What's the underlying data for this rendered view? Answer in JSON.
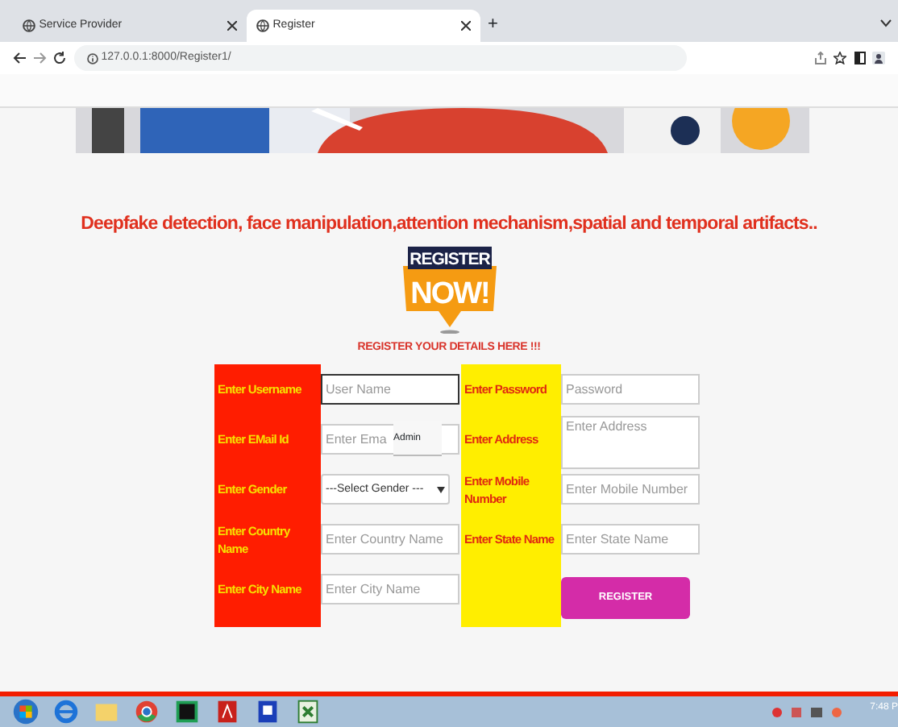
{
  "browser": {
    "tabs": [
      {
        "title": "Service Provider",
        "selected": false
      },
      {
        "title": "Register",
        "selected": true
      }
    ],
    "new_tab": "+",
    "url": "127.0.0.1:8000/Register1/"
  },
  "heading": "Deepfake detection, face manipulation,attention mechanism,spatial and temporal artifacts..",
  "badge": {
    "top": "REGISTER",
    "bottom": "NOW!"
  },
  "subheading": "REGISTER YOUR DETAILS HERE !!!",
  "form": {
    "left": [
      {
        "label": "Enter Username",
        "kind": "input",
        "placeholder": "User Name",
        "focused": true
      },
      {
        "label": "Enter EMail Id",
        "kind": "input",
        "placeholder": "Enter Ema",
        "focused": false,
        "suggestion": "Admin"
      },
      {
        "label": "Enter Gender",
        "kind": "select",
        "value": "---Select Gender ---",
        "focused": false
      },
      {
        "label": "Enter Country Name",
        "kind": "input",
        "placeholder": "Enter Country Name",
        "focused": false
      },
      {
        "label": "Enter City Name",
        "kind": "input",
        "placeholder": "Enter City Name",
        "focused": false
      }
    ],
    "right": [
      {
        "label": "Enter Password",
        "kind": "input",
        "placeholder": "Password",
        "focused": false
      },
      {
        "label": "Enter Address",
        "kind": "textarea",
        "placeholder": "Enter Address",
        "focused": false
      },
      {
        "label": "Enter Mobile Number",
        "kind": "input",
        "placeholder": "Enter Mobile Number",
        "focused": false
      },
      {
        "label": "Enter State Name",
        "kind": "input",
        "placeholder": "Enter State Name",
        "focused": false
      }
    ],
    "submit": "REGISTER"
  },
  "taskbar": {
    "clock": "7:48 P"
  }
}
